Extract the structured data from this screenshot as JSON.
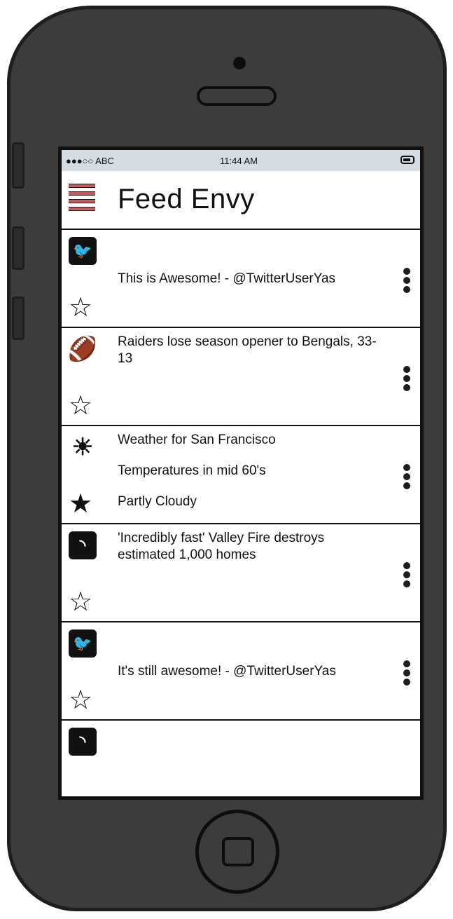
{
  "status_bar": {
    "carrier": "●●●○○ ABC",
    "time": "11:44 AM"
  },
  "header": {
    "title": "Feed Envy"
  },
  "feed": [
    {
      "source": "twitter-icon",
      "lines": [
        "This is Awesome! - @TwitterUserYas"
      ],
      "starred": false
    },
    {
      "source": "football-icon",
      "lines": [
        "Raiders lose season opener to Bengals, 33-13"
      ],
      "starred": false
    },
    {
      "source": "sun-icon",
      "lines": [
        "Weather for San Francisco",
        "Temperatures in mid 60's",
        "Partly Cloudy"
      ],
      "starred": true
    },
    {
      "source": "rss-icon",
      "lines": [
        "'Incredibly fast' Valley Fire destroys estimated 1,000 homes"
      ],
      "starred": false
    },
    {
      "source": "twitter-icon",
      "lines": [
        "It's still awesome! - @TwitterUserYas"
      ],
      "starred": false
    },
    {
      "source": "rss-icon",
      "lines": [],
      "starred": false
    }
  ],
  "icons": {
    "star_empty": "☆",
    "star_filled": "★",
    "twitter": "🐦",
    "football": "🏈",
    "sun": "☀",
    "rss": "◝"
  },
  "colors": {
    "menu_accent": "#c45a5a",
    "status_bar_bg": "#d6dde2",
    "phone_body": "#3c3c3c"
  }
}
